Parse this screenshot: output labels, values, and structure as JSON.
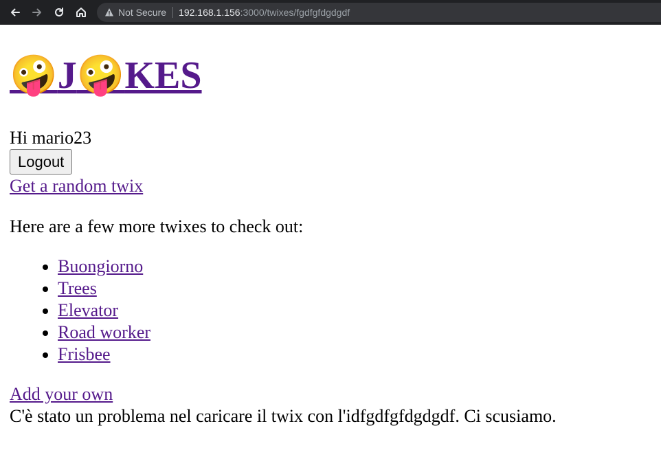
{
  "browser": {
    "security_label": "Not Secure",
    "url_host": "192.168.1.156",
    "url_rest": ":3000/twixes/fgdfgfdgdgdf"
  },
  "header": {
    "emoji": "🤪",
    "title_letter_j": "J",
    "title_rest": "KES"
  },
  "user": {
    "greeting": "Hi mario23",
    "logout_label": "Logout"
  },
  "main": {
    "random_link": "Get a random twix",
    "intro": "Here are a few more twixes to check out:",
    "twixes": [
      "Buongiorno",
      "Trees",
      "Elevator",
      "Road worker",
      "Frisbee"
    ],
    "add_link": "Add your own",
    "error": "C'è stato un problema nel caricare il twix con l'idfgdfgfdgdgdf. Ci scusiamo."
  }
}
